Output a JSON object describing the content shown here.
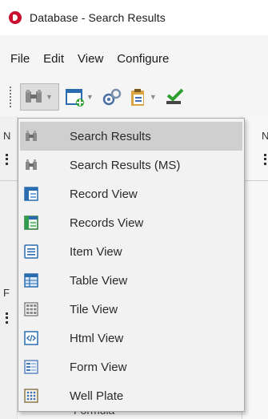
{
  "window": {
    "title": "Database - Search Results"
  },
  "menubar": {
    "items": [
      "File",
      "Edit",
      "View",
      "Configure"
    ]
  },
  "edges": {
    "left_top": "N",
    "right_top": "N",
    "left_mid": "F"
  },
  "formula_peek": "Formula",
  "dropdown": {
    "selected_index": 0,
    "items": [
      {
        "label": "Search Results",
        "icon": "binoculars-icon"
      },
      {
        "label": "Search Results (MS)",
        "icon": "binoculars-icon"
      },
      {
        "label": "Record View",
        "icon": "record-view-icon"
      },
      {
        "label": "Records View",
        "icon": "records-view-icon"
      },
      {
        "label": "Item View",
        "icon": "item-view-icon"
      },
      {
        "label": "Table View",
        "icon": "table-view-icon"
      },
      {
        "label": "Tile View",
        "icon": "tile-view-icon"
      },
      {
        "label": "Html View",
        "icon": "html-view-icon"
      },
      {
        "label": "Form View",
        "icon": "form-view-icon"
      },
      {
        "label": "Well Plate",
        "icon": "well-plate-icon"
      }
    ]
  },
  "colors": {
    "accent": "#c8102e",
    "selection": "#cfcfcf",
    "menu_bg": "#f2f2f2"
  }
}
